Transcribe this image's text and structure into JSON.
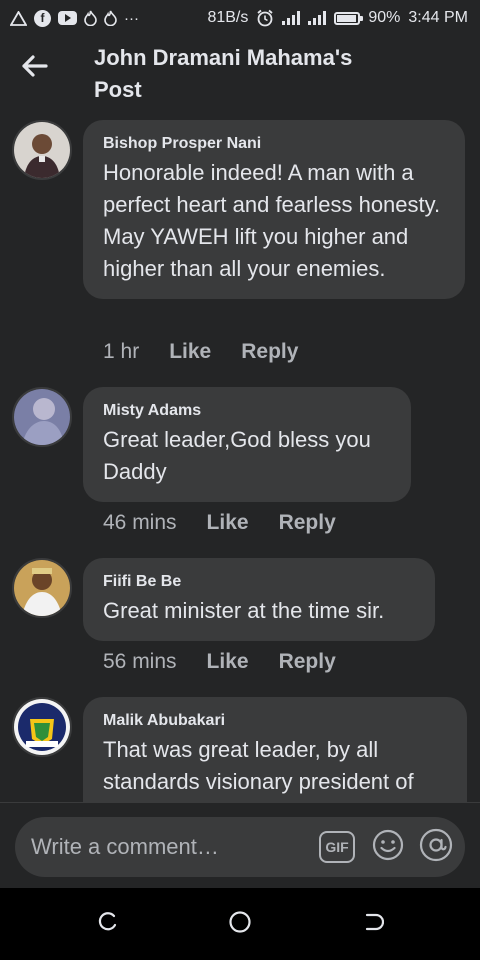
{
  "status_bar": {
    "speed": "81B/s",
    "battery": "90%",
    "time": "3:44 PM",
    "left_icons": [
      "alert-triangle-icon",
      "facebook-icon",
      "youtube-icon",
      "flame-icon",
      "flame-icon",
      "more-dots-icon"
    ],
    "right_icons": [
      "alarm-icon",
      "signal-icon",
      "wifi-signal-icon",
      "battery-icon"
    ]
  },
  "header": {
    "title": "John Dramani Mahama's Post",
    "back_icon": "arrow-left-icon"
  },
  "comments": [
    {
      "author": "Bishop Prosper Nani",
      "text": "Honorable indeed! A man with a perfect heart and fearless honesty. May YAWEH lift you higher and higher than all your enemies.",
      "time": "1 hr",
      "like": "Like",
      "reply": "Reply"
    },
    {
      "author": "Misty Adams",
      "text": "Great leader,God bless you Daddy",
      "time": "46 mins",
      "like": "Like",
      "reply": "Reply"
    },
    {
      "author": "Fiifi Be Be",
      "text": "Great minister at the time sir.",
      "time": "56 mins",
      "like": "Like",
      "reply": "Reply"
    },
    {
      "author": "Malik Abubakari",
      "text": "That was great leader, by all standards visionary president of"
    }
  ],
  "composer": {
    "placeholder": "Write a comment…",
    "gif_label": "GIF",
    "emoji_icon": "smiley-icon",
    "mention_icon": "at-sign-icon"
  },
  "nav_bar": {
    "icons": [
      "recent-apps-icon",
      "home-icon",
      "back-icon"
    ]
  },
  "colors": {
    "background": "#242526",
    "bubble": "#3a3b3c",
    "text": "#e4e6eb",
    "secondary_text": "#b0b3b8"
  }
}
